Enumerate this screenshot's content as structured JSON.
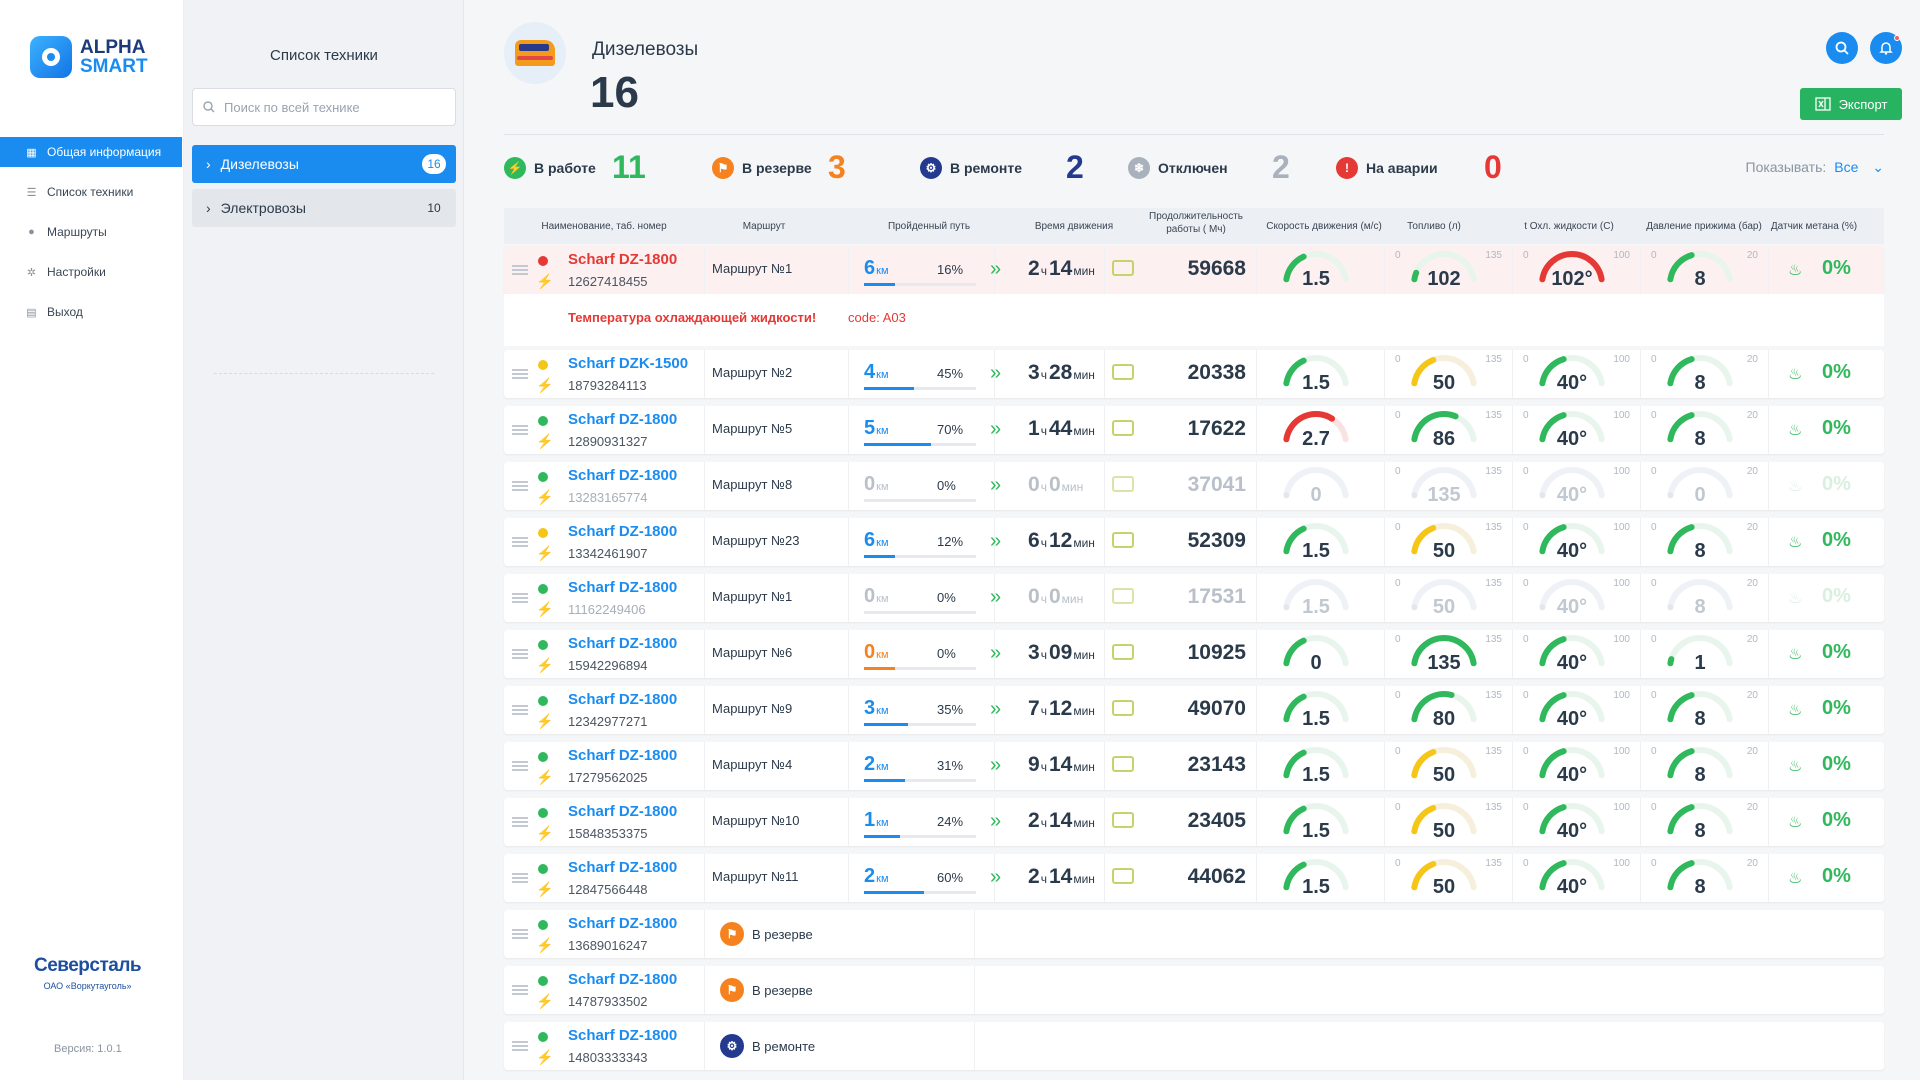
{
  "app": {
    "logo_line1": "ALPHA",
    "logo_line2": "SMART",
    "version": "Версия: 1.0.1",
    "company": "Северсталь",
    "company_sub": "ОАО «Воркутауголь»"
  },
  "nav": [
    {
      "label": "Общая информация",
      "icon": "dashboard-icon",
      "active": true
    },
    {
      "label": "Список техники",
      "icon": "list-icon",
      "active": false
    },
    {
      "label": "Маршруты",
      "icon": "pin-icon",
      "active": false
    },
    {
      "label": "Настройки",
      "icon": "gear-icon",
      "active": false
    },
    {
      "label": "Выход",
      "icon": "exit-icon",
      "active": false
    }
  ],
  "panel": {
    "title": "Список техники",
    "search_placeholder": "Поиск по всей технике",
    "items": [
      {
        "label": "Дизелевозы",
        "count": "16",
        "active": true
      },
      {
        "label": "Электровозы",
        "count": "10",
        "active": false
      }
    ]
  },
  "header": {
    "title": "Дизелевозы",
    "count": "16",
    "export_label": "Экспорт"
  },
  "summary": [
    {
      "label": "В работе",
      "value": "11",
      "color": "#2fb85c"
    },
    {
      "label": "В резерве",
      "value": "3",
      "color": "#f5821f"
    },
    {
      "label": "В ремонте",
      "value": "2",
      "color": "#233a8f"
    },
    {
      "label": "Отключен",
      "value": "2",
      "color": "#a9b1bc"
    },
    {
      "label": "На аварии",
      "value": "0",
      "color": "#e53935"
    }
  ],
  "show_label": "Показывать:",
  "show_value": "Все",
  "columns": [
    "Наименование, таб. номер",
    "Маршрут",
    "Пройденный путь",
    "Время движения",
    "Продолжительность работы ( Мч)",
    "Скорость движения (м/с)",
    "Топливо (л)",
    "t Охл. жидкости (С)",
    "Давление прижима (бар)",
    "Датчик метана (%)"
  ],
  "gauge_limits": {
    "fuel": [
      "0",
      "135"
    ],
    "coolant": [
      "0",
      "100"
    ],
    "pressure": [
      "0",
      "20"
    ]
  },
  "alarm": {
    "text": "Температура охлаждающей жидкости!",
    "code": "code: A03"
  },
  "units": {
    "km": "км",
    "h": "ч",
    "min": "мин"
  },
  "rows": [
    {
      "name": "Scharf DZ-1800",
      "num": "12627418455",
      "status": "#e53935",
      "route": "Маршрут №1",
      "km": "6",
      "pct": "16%",
      "p": 0.16,
      "h": "2",
      "m": "14",
      "hours": "59668",
      "speed": "1.5",
      "speed_f": 0.35,
      "fuel": "102",
      "fuel_f": 0.08,
      "cool": "102°",
      "cool_f": 1.0,
      "press": "8",
      "press_f": 0.4,
      "meth": "0%",
      "alarm": true
    },
    {
      "name": "Scharf DZK-1500",
      "num": "18793284113",
      "status": "#f5c518",
      "route": "Маршрут №2",
      "km": "4",
      "pct": "45%",
      "p": 0.45,
      "h": "3",
      "m": "28",
      "hours": "20338",
      "speed": "1.5",
      "speed_f": 0.35,
      "fuel": "50",
      "fuel_f": 0.37,
      "cool": "40°",
      "cool_f": 0.4,
      "press": "8",
      "press_f": 0.4,
      "meth": "0%"
    },
    {
      "name": "Scharf DZ-1800",
      "num": "12890931327",
      "status": "#2fb85c",
      "route": "Маршрут №5",
      "km": "5",
      "pct": "70%",
      "p": 0.7,
      "h": "1",
      "m": "44",
      "hours": "17622",
      "speed": "2.7",
      "speed_f": 0.7,
      "fuel": "86",
      "fuel_f": 0.64,
      "cool": "40°",
      "cool_f": 0.4,
      "press": "8",
      "press_f": 0.4,
      "meth": "0%"
    },
    {
      "name": "Scharf DZ-1800",
      "num": "13283165774",
      "status": "#2fb85c",
      "route": "Маршрут №8",
      "km": "0",
      "pct": "0%",
      "p": 0,
      "h": "0",
      "m": "0",
      "hours": "37041",
      "speed": "0",
      "speed_f": 0,
      "fuel": "135",
      "fuel_f": 1.0,
      "cool": "40°",
      "cool_f": 0.4,
      "press": "0",
      "press_f": 0,
      "meth": "0%",
      "dim": true
    },
    {
      "name": "Scharf DZ-1800",
      "num": "13342461907",
      "status": "#f5c518",
      "route": "Маршрут №23",
      "km": "6",
      "pct": "12%",
      "p": 0.12,
      "h": "6",
      "m": "12",
      "hours": "52309",
      "speed": "1.5",
      "speed_f": 0.35,
      "fuel": "50",
      "fuel_f": 0.37,
      "cool": "40°",
      "cool_f": 0.4,
      "press": "8",
      "press_f": 0.4,
      "meth": "0%"
    },
    {
      "name": "Scharf DZ-1800",
      "num": "11162249406",
      "status": "#2fb85c",
      "route": "Маршрут №1",
      "km": "0",
      "pct": "0%",
      "p": 0,
      "h": "0",
      "m": "0",
      "hours": "17531",
      "speed": "1.5",
      "speed_f": 0.35,
      "fuel": "50",
      "fuel_f": 0.37,
      "cool": "40°",
      "cool_f": 0.4,
      "press": "8",
      "press_f": 0.4,
      "meth": "0%",
      "dim": true
    },
    {
      "name": "Scharf DZ-1800",
      "num": "15942296894",
      "status": "#2fb85c",
      "route": "Маршрут №6",
      "km": "0",
      "pct": "0%",
      "p": 0,
      "h": "3",
      "m": "09",
      "hours": "10925",
      "speed": "0",
      "speed_f": 0.35,
      "fuel": "135",
      "fuel_f": 1.0,
      "cool": "40°",
      "cool_f": 0.4,
      "press": "1",
      "press_f": 0.05,
      "meth": "0%",
      "orange": true
    },
    {
      "name": "Scharf DZ-1800",
      "num": "12342977271",
      "status": "#2fb85c",
      "route": "Маршрут №9",
      "km": "3",
      "pct": "35%",
      "p": 0.35,
      "h": "7",
      "m": "12",
      "hours": "49070",
      "speed": "1.5",
      "speed_f": 0.35,
      "fuel": "80",
      "fuel_f": 0.59,
      "cool": "40°",
      "cool_f": 0.4,
      "press": "8",
      "press_f": 0.4,
      "meth": "0%"
    },
    {
      "name": "Scharf DZ-1800",
      "num": "17279562025",
      "status": "#2fb85c",
      "route": "Маршрут №4",
      "km": "2",
      "pct": "31%",
      "p": 0.31,
      "h": "9",
      "m": "14",
      "hours": "23143",
      "speed": "1.5",
      "speed_f": 0.35,
      "fuel": "50",
      "fuel_f": 0.37,
      "cool": "40°",
      "cool_f": 0.4,
      "press": "8",
      "press_f": 0.4,
      "meth": "0%"
    },
    {
      "name": "Scharf DZ-1800",
      "num": "15848353375",
      "status": "#2fb85c",
      "route": "Маршрут №10",
      "km": "1",
      "pct": "24%",
      "p": 0.24,
      "h": "2",
      "m": "14",
      "hours": "23405",
      "speed": "1.5",
      "speed_f": 0.35,
      "fuel": "50",
      "fuel_f": 0.37,
      "cool": "40°",
      "cool_f": 0.4,
      "press": "8",
      "press_f": 0.4,
      "meth": "0%"
    },
    {
      "name": "Scharf DZ-1800",
      "num": "12847566448",
      "status": "#2fb85c",
      "route": "Маршрут №11",
      "km": "2",
      "pct": "60%",
      "p": 0.6,
      "h": "2",
      "m": "14",
      "hours": "44062",
      "speed": "1.5",
      "speed_f": 0.35,
      "fuel": "50",
      "fuel_f": 0.37,
      "cool": "40°",
      "cool_f": 0.4,
      "press": "8",
      "press_f": 0.4,
      "meth": "0%"
    },
    {
      "name": "Scharf DZ-1800",
      "num": "13689016247",
      "status": "#2fb85c",
      "state": "В резерве",
      "state_color": "#f5821f"
    },
    {
      "name": "Scharf DZ-1800",
      "num": "14787933502",
      "status": "#2fb85c",
      "state": "В резерве",
      "state_color": "#f5821f"
    },
    {
      "name": "Scharf DZ-1800",
      "num": "14803333343",
      "status": "#2fb85c",
      "state": "В ремонте",
      "state_color": "#233a8f"
    }
  ]
}
